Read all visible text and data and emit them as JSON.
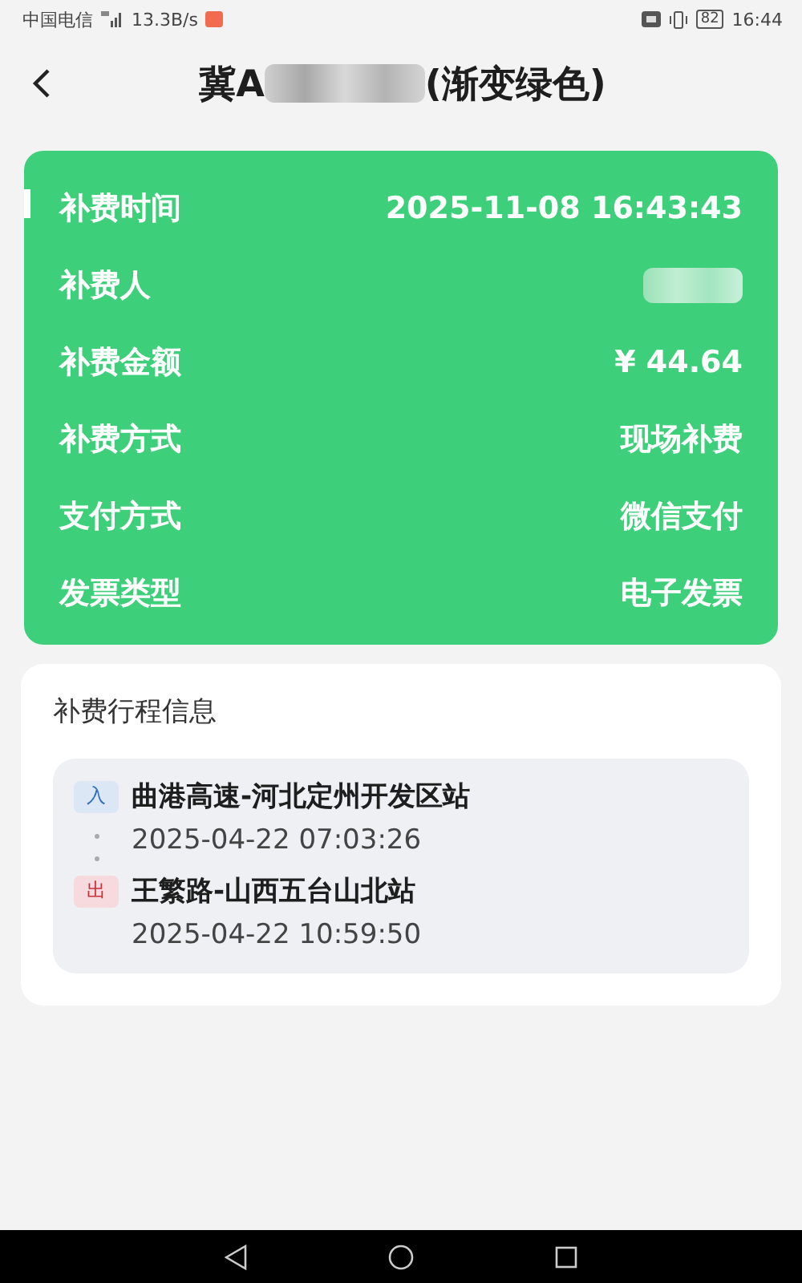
{
  "status_bar": {
    "carrier": "中国电信",
    "speed": "13.3B/s",
    "battery": "82",
    "time": "16:44"
  },
  "header": {
    "title_start": "冀A",
    "title_end": "(渐变绿色)"
  },
  "details": [
    {
      "label": "补费时间",
      "value": "2025-11-08 16:43:43",
      "redacted": false
    },
    {
      "label": "补费人",
      "redacted": true
    },
    {
      "label": "补费金额",
      "value": "¥ 44.64",
      "redacted": false
    },
    {
      "label": "补费方式",
      "value": "现场补费",
      "redacted": false
    },
    {
      "label": "支付方式",
      "value": "微信支付",
      "redacted": false
    },
    {
      "label": "发票类型",
      "value": "电子发票",
      "redacted": false
    }
  ],
  "trip": {
    "title": "补费行程信息",
    "stops": [
      {
        "kind": "entry",
        "badge": "入",
        "station": "曲港高速-河北定州开发区站",
        "time": "2025-04-22 07:03:26"
      },
      {
        "kind": "exit",
        "badge": "出",
        "station": "王繁路-山西五台山北站",
        "time": "2025-04-22 10:59:50"
      }
    ]
  }
}
